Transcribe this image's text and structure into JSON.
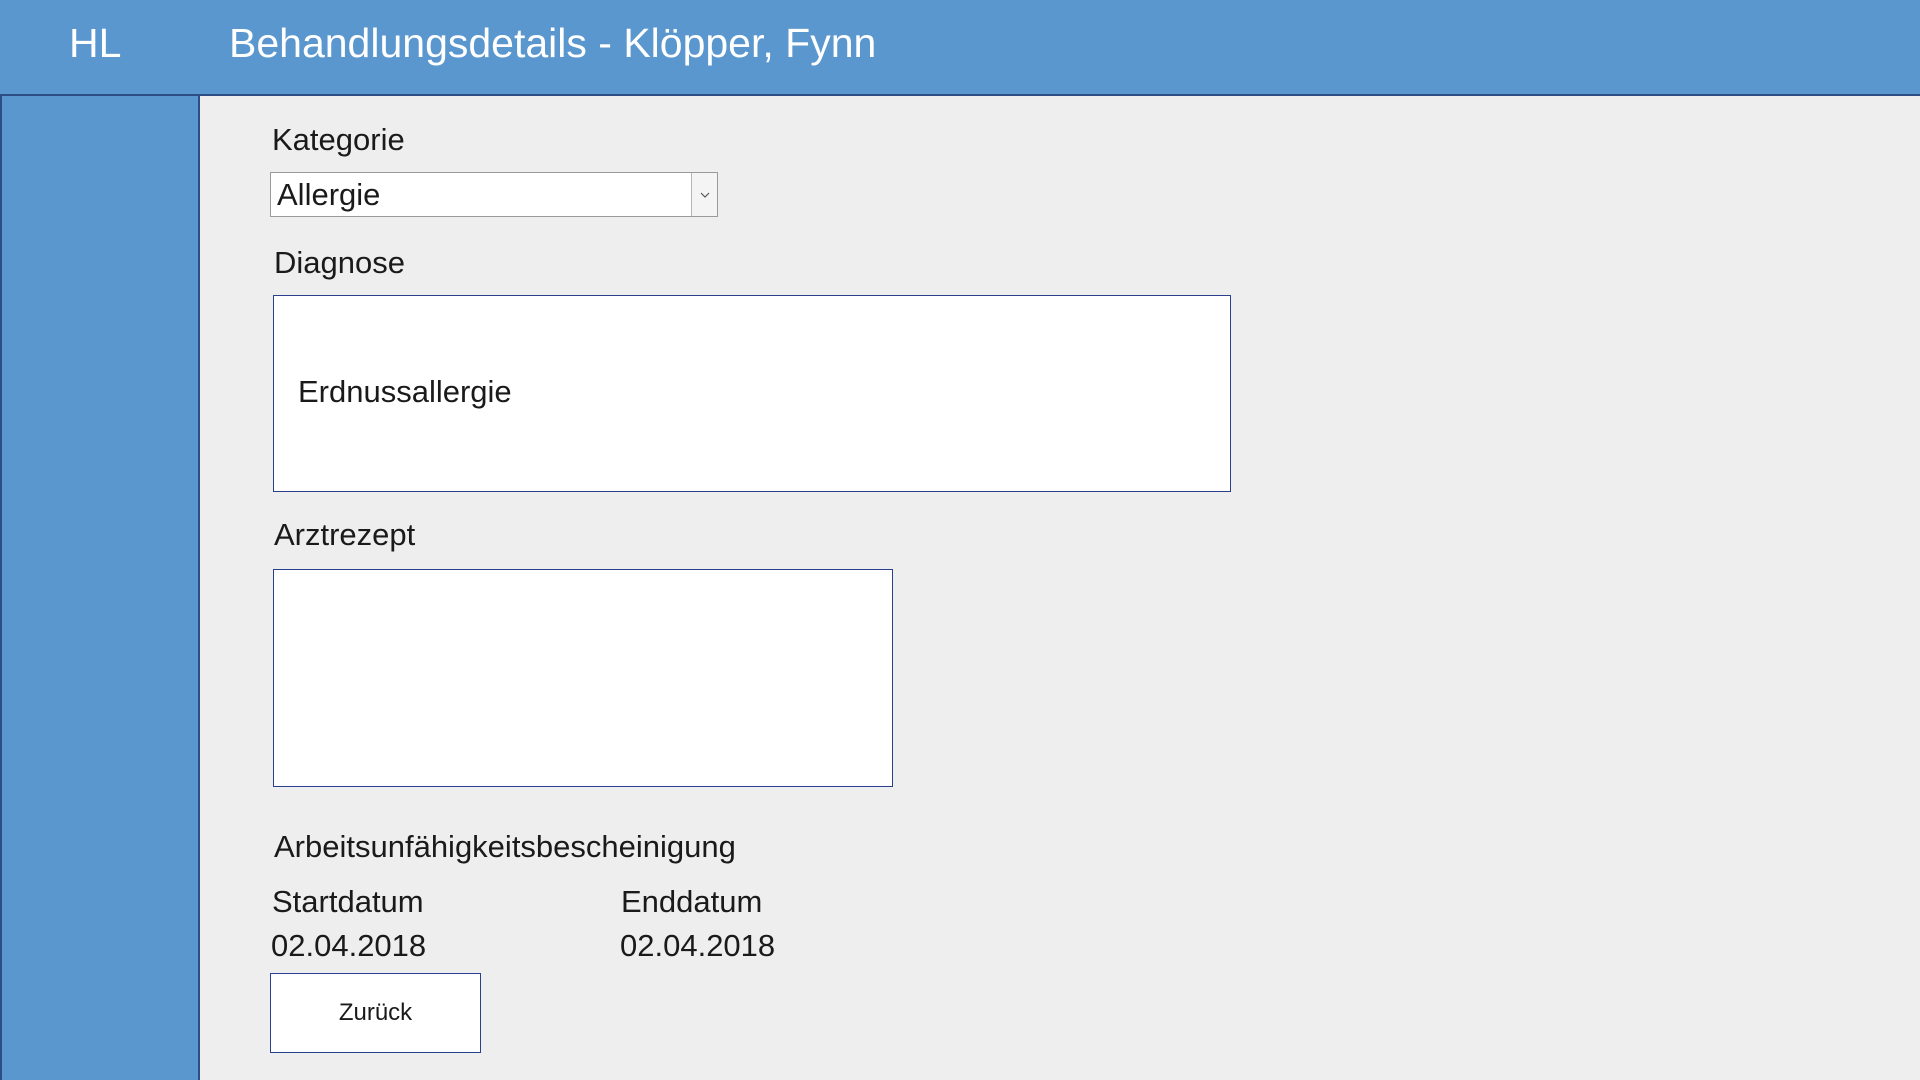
{
  "header": {
    "app_abbr": "HL",
    "title": "Behandlungsdetails - Klöpper, Fynn"
  },
  "form": {
    "kategorie": {
      "label": "Kategorie",
      "value": "Allergie"
    },
    "diagnose": {
      "label": "Diagnose",
      "value": "Erdnussallergie"
    },
    "arztrezept": {
      "label": "Arztrezept",
      "value": ""
    },
    "au": {
      "heading": "Arbeitsunfähigkeitsbescheinigung",
      "start_label": "Startdatum",
      "start_value": "02.04.2018",
      "end_label": "Enddatum",
      "end_value": "02.04.2018"
    },
    "back_button_label": "Zurück"
  },
  "colors": {
    "header_bg": "#5b97cf",
    "border_accent": "#2b3f8f",
    "page_bg": "#eeeeee"
  }
}
